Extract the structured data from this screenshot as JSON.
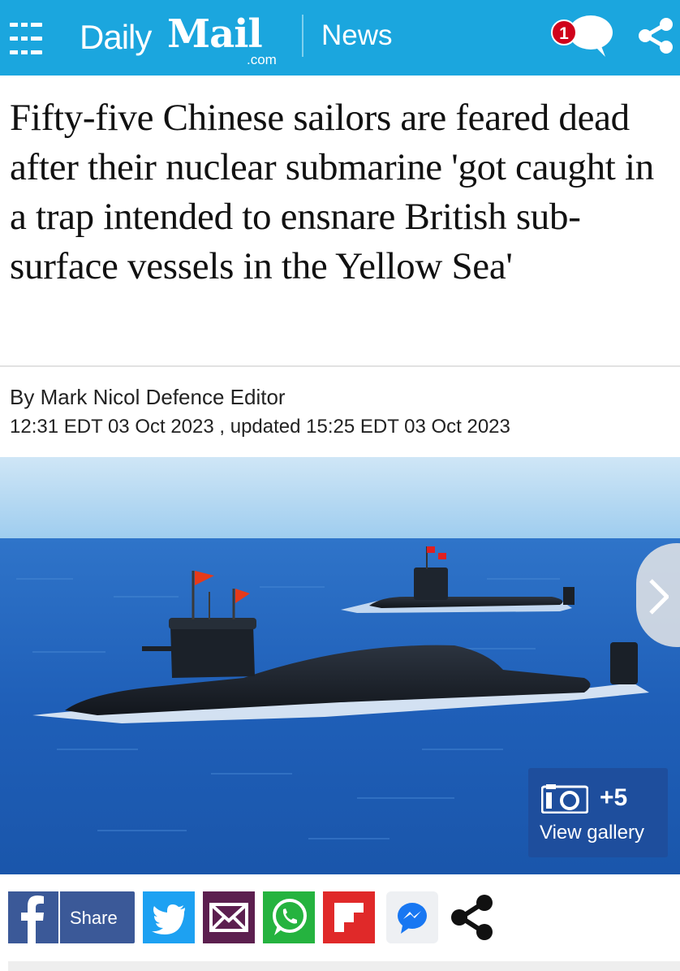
{
  "header": {
    "logo_daily": "Daily",
    "logo_mail": "Mail",
    "logo_com": ".com",
    "section": "News",
    "comment_count": "1",
    "brand_color": "#1ba6de"
  },
  "article": {
    "headline": "Fifty-five Chinese sailors are feared dead after their nuclear submarine 'got caught in a trap intended to ensnare British sub-surface vessels in the Yellow Sea'",
    "byline_prefix": "By ",
    "author": "Mark Nicol Defence Editor",
    "dates": "12:31 EDT 03 Oct 2023 , updated 15:25 EDT 03 Oct 2023"
  },
  "gallery": {
    "count": "+5",
    "label": "View gallery",
    "icon": "camera-icon"
  },
  "share_bar": {
    "facebook_label": "Share",
    "icons": [
      "facebook-icon",
      "twitter-icon",
      "email-icon",
      "whatsapp-icon",
      "flipboard-icon",
      "messenger-icon",
      "share-icon"
    ]
  }
}
